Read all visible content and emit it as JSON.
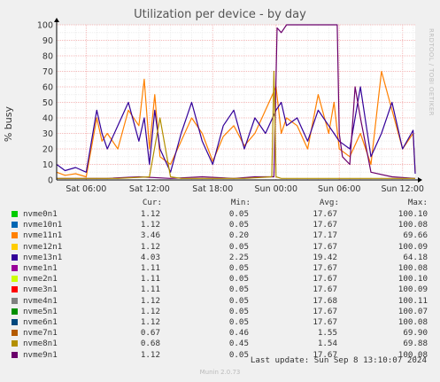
{
  "title": "Utilization per device - by day",
  "side_watermark": "RRDTOOL / TOBI OETIKER",
  "ylabel": "% busy",
  "legend_headers": {
    "cur": "Cur:",
    "min": "Min:",
    "avg": "Avg:",
    "max": "Max:"
  },
  "legend": [
    {
      "name": "nvme0n1",
      "cur": "1.12",
      "min": "0.05",
      "avg": "17.67",
      "max": "100.10",
      "color": "#00cc00"
    },
    {
      "name": "nvme10n1",
      "cur": "1.12",
      "min": "0.05",
      "avg": "17.67",
      "max": "100.08",
      "color": "#0066b3"
    },
    {
      "name": "nvme11n1",
      "cur": "3.46",
      "min": "0.20",
      "avg": "17.17",
      "max": "69.66",
      "color": "#ff8000"
    },
    {
      "name": "nvme12n1",
      "cur": "1.12",
      "min": "0.05",
      "avg": "17.67",
      "max": "100.09",
      "color": "#ffcc00"
    },
    {
      "name": "nvme13n1",
      "cur": "4.03",
      "min": "2.25",
      "avg": "19.42",
      "max": "64.18",
      "color": "#330099"
    },
    {
      "name": "nvme1n1",
      "cur": "1.11",
      "min": "0.05",
      "avg": "17.67",
      "max": "100.08",
      "color": "#990099"
    },
    {
      "name": "nvme2n1",
      "cur": "1.11",
      "min": "0.05",
      "avg": "17.67",
      "max": "100.10",
      "color": "#ccff00"
    },
    {
      "name": "nvme3n1",
      "cur": "1.11",
      "min": "0.05",
      "avg": "17.67",
      "max": "100.09",
      "color": "#ff0000"
    },
    {
      "name": "nvme4n1",
      "cur": "1.12",
      "min": "0.05",
      "avg": "17.68",
      "max": "100.11",
      "color": "#808080"
    },
    {
      "name": "nvme5n1",
      "cur": "1.12",
      "min": "0.05",
      "avg": "17.67",
      "max": "100.07",
      "color": "#008f00"
    },
    {
      "name": "nvme6n1",
      "cur": "1.12",
      "min": "0.05",
      "avg": "17.67",
      "max": "100.08",
      "color": "#00487d"
    },
    {
      "name": "nvme7n1",
      "cur": "0.67",
      "min": "0.46",
      "avg": "1.55",
      "max": "69.90",
      "color": "#b35a00"
    },
    {
      "name": "nvme8n1",
      "cur": "0.68",
      "min": "0.45",
      "avg": "1.54",
      "max": "69.88",
      "color": "#b38f00"
    },
    {
      "name": "nvme9n1",
      "cur": "1.12",
      "min": "0.05",
      "avg": "17.67",
      "max": "100.08",
      "color": "#6b006b"
    }
  ],
  "last_update": "Last update: Sun Sep  8 13:10:07 2024",
  "footer": "Munin 2.0.73",
  "chart_data": {
    "type": "line",
    "title": "Utilization per device - by day",
    "xlabel": "",
    "ylabel": "% busy",
    "ylim": [
      0,
      100
    ],
    "yticks": [
      0,
      10,
      20,
      30,
      40,
      50,
      60,
      70,
      80,
      90,
      100
    ],
    "x_unit": "hours",
    "xlim": [
      3.5,
      13.25
    ],
    "xticks": [
      {
        "x": 6,
        "label": "Sat 06:00"
      },
      {
        "x": 12,
        "label": "Sat 12:00"
      },
      {
        "x": 18,
        "label": "Sat 18:00"
      },
      {
        "x": 24,
        "label": "Sun 00:00"
      },
      {
        "x": 30,
        "label": "Sun 06:00"
      },
      {
        "x": 36,
        "label": "Sun 12:00"
      }
    ],
    "x_range_hours": [
      3.2,
      37.2
    ],
    "grid": true,
    "series": [
      {
        "name": "nvme11n1",
        "color": "#ff8000",
        "x": [
          3.2,
          4,
          5,
          6,
          7,
          7.5,
          8,
          9,
          10,
          11,
          11.5,
          12,
          12.5,
          13,
          14,
          15,
          16,
          17,
          18,
          19,
          20,
          21,
          22,
          23,
          24,
          24.5,
          25,
          26,
          27,
          28,
          29,
          29.5,
          30,
          31,
          32,
          33,
          34,
          35,
          36,
          37,
          37.2
        ],
        "y": [
          5,
          3,
          4,
          2,
          40,
          25,
          30,
          20,
          45,
          35,
          65,
          20,
          55,
          15,
          10,
          25,
          40,
          30,
          12,
          28,
          35,
          22,
          30,
          45,
          60,
          30,
          40,
          35,
          20,
          55,
          30,
          50,
          20,
          15,
          30,
          10,
          70,
          45,
          20,
          30,
          5
        ]
      },
      {
        "name": "nvme13n1",
        "color": "#330099",
        "x": [
          3.2,
          4,
          5,
          6,
          7,
          7.5,
          8,
          9,
          10,
          11,
          11.5,
          12,
          12.5,
          13,
          14,
          15,
          16,
          17,
          18,
          19,
          20,
          21,
          22,
          23,
          24,
          24.5,
          25,
          26,
          27,
          28,
          29,
          29.5,
          30,
          31,
          32,
          33,
          34,
          35,
          36,
          37,
          37.2
        ],
        "y": [
          10,
          6,
          8,
          5,
          45,
          30,
          20,
          35,
          50,
          25,
          40,
          10,
          45,
          20,
          5,
          30,
          50,
          25,
          10,
          35,
          45,
          20,
          40,
          30,
          45,
          50,
          35,
          40,
          25,
          45,
          35,
          30,
          25,
          20,
          60,
          15,
          30,
          50,
          20,
          32,
          4
        ]
      },
      {
        "name": "nvme9n1",
        "color": "#6b006b",
        "x": [
          3.2,
          5,
          8,
          11,
          14,
          17,
          20,
          22,
          23.8,
          24.1,
          24.5,
          25,
          26,
          27,
          28,
          29,
          29.5,
          29.8,
          30,
          30.3,
          31,
          31.5,
          32,
          33,
          35,
          37.2
        ],
        "y": [
          1,
          1,
          1,
          2,
          1,
          2,
          1,
          2,
          2,
          98,
          95,
          100,
          100,
          100,
          100,
          100,
          100,
          100,
          30,
          15,
          10,
          60,
          40,
          5,
          2,
          1
        ]
      },
      {
        "name": "nvme8n1",
        "color": "#b38f00",
        "x": [
          3.2,
          6,
          9,
          12,
          13,
          14,
          15,
          18,
          21,
          23.6,
          23.8,
          24,
          24.5,
          27,
          30,
          33,
          36,
          37.2
        ],
        "y": [
          1,
          1,
          1,
          2,
          40,
          2,
          1,
          1,
          1,
          2,
          70,
          2,
          1,
          1,
          1,
          1,
          1,
          1
        ]
      }
    ]
  }
}
